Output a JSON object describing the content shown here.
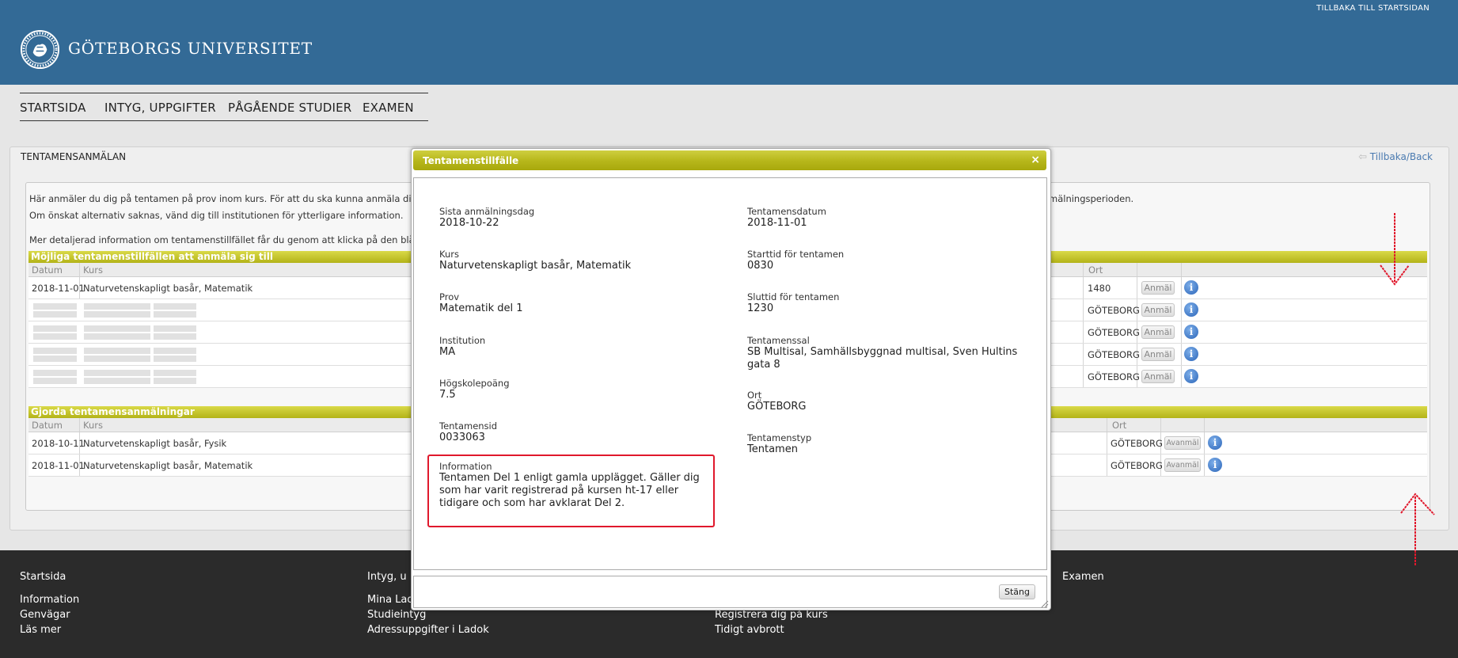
{
  "header": {
    "university_name": "GÖTEBORGS UNIVERSITET",
    "back_home": "TILLBAKA TILL STARTSIDAN",
    "colors": {
      "header_bg": "#336a96",
      "section_bar": "#c1c12a",
      "footer_bg": "#2b2b2b"
    }
  },
  "nav": {
    "items": [
      {
        "label": "STARTSIDA"
      },
      {
        "label": "INTYG, UPPGIFTER"
      },
      {
        "label": "PÅGÅENDE STUDIER"
      },
      {
        "label": "EXAMEN"
      }
    ]
  },
  "page": {
    "title": "TENTAMENSANMÄLAN",
    "back_link": "Tillbaka/Back",
    "intro": [
      "Här anmäler du dig på tentamen på prov inom kurs. För att du ska kunna anmäla di",
      "Om önskat alternativ saknas, vänd dig till institutionen för ytterligare information.",
      "Mer detaljerad information om tentamenstillfället får du genom att klicka på den blå"
    ],
    "intro_tail": "mälningsperioden."
  },
  "available": {
    "section_title": "Möjliga tentamenstillfällen att anmäla sig till",
    "columns": {
      "date": "Datum",
      "course": "Kurs",
      "place": "Ort"
    },
    "rows": [
      {
        "date": "2018-11-01",
        "course": "Naturvetenskapligt basår, Matematik",
        "place": "1480",
        "action": "Anmäl"
      },
      {
        "date": "",
        "course": "",
        "place": "GÖTEBORG",
        "action": "Anmäl"
      },
      {
        "date": "",
        "course": "",
        "place": "GÖTEBORG",
        "action": "Anmäl"
      },
      {
        "date": "",
        "course": "",
        "place": "GÖTEBORG",
        "action": "Anmäl"
      },
      {
        "date": "",
        "course": "",
        "place": "GÖTEBORG",
        "action": "Anmäl"
      }
    ]
  },
  "registered": {
    "section_title": "Gjorda tentamensanmälningar",
    "columns": {
      "date": "Datum",
      "course": "Kurs",
      "place": "Ort"
    },
    "rows": [
      {
        "date": "2018-10-11",
        "course": "Naturvetenskapligt basår, Fysik",
        "place": "GÖTEBORG",
        "action": "Avanmäl"
      },
      {
        "date": "2018-11-01",
        "course": "Naturvetenskapligt basår, Matematik",
        "place": "GÖTEBORG",
        "action": "Avanmäl"
      }
    ]
  },
  "footer": {
    "columns": [
      {
        "heading": "Startsida",
        "links": [
          "Information",
          "Genvägar",
          "Läs mer"
        ]
      },
      {
        "heading": "Intyg, u",
        "links": [
          "Mina Lad",
          "Studieintyg",
          "Adressuppgifter i Ladok"
        ]
      },
      {
        "heading": "",
        "links": [
          "Registrera dig på kurs",
          "Tidigt avbrott"
        ]
      },
      {
        "heading": "Examen",
        "links": []
      }
    ]
  },
  "modal": {
    "title": "Tentamenstillfälle",
    "close_icon": "×",
    "close_button": "Stäng",
    "left_fields": [
      {
        "label": "Sista anmälningsdag",
        "value": "2018-10-22"
      },
      {
        "label": "Kurs",
        "value": "Naturvetenskapligt basår, Matematik"
      },
      {
        "label": "Prov",
        "value": "Matematik del 1"
      },
      {
        "label": "Institution",
        "value": "MA"
      },
      {
        "label": "Högskolepoäng",
        "value": "7.5"
      },
      {
        "label": "Tentamensid",
        "value": "0033063"
      }
    ],
    "info": {
      "label": "Information",
      "value": "Tentamen Del 1 enligt gamla upplägget. Gäller dig som har varit registrerad på kursen ht-17 eller tidigare och som har avklarat Del 2."
    },
    "right_fields": [
      {
        "label": "Tentamensdatum",
        "value": "2018-11-01"
      },
      {
        "label": "Starttid för tentamen",
        "value": "0830"
      },
      {
        "label": "Sluttid för tentamen",
        "value": "1230"
      },
      {
        "label": "Tentamenssal",
        "value": "SB Multisal, Samhällsbyggnad multisal, Sven Hultins gata 8"
      },
      {
        "label": "Ort",
        "value": "GÖTEBORG"
      },
      {
        "label": "Tentamenstyp",
        "value": "Tentamen"
      }
    ]
  }
}
